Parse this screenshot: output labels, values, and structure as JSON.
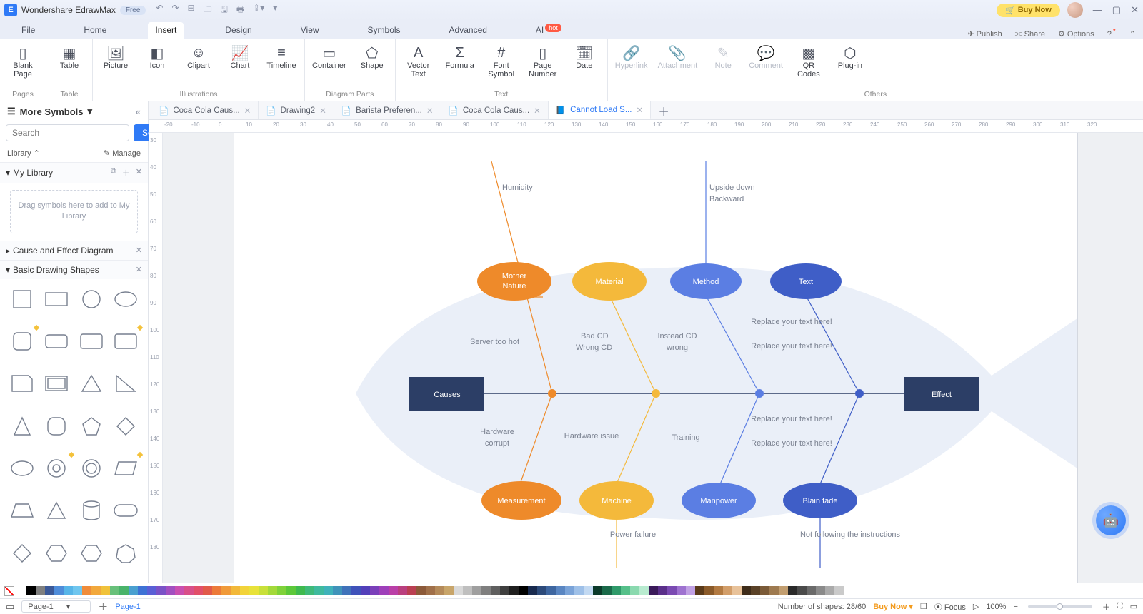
{
  "app": {
    "title": "Wondershare EdrawMax",
    "edition": "Free",
    "buy": "Buy Now"
  },
  "menu": {
    "items": [
      "File",
      "Home",
      "Insert",
      "Design",
      "View",
      "Symbols",
      "Advanced",
      "AI"
    ],
    "active": "Insert",
    "right": {
      "publish": "Publish",
      "share": "Share",
      "options": "Options"
    }
  },
  "ribbon": {
    "pages": {
      "label": "Pages",
      "blank": "Blank\nPage"
    },
    "table": {
      "label": "Table",
      "btn": "Table"
    },
    "illus": {
      "label": "Illustrations",
      "picture": "Picture",
      "icon": "Icon",
      "clipart": "Clipart",
      "chart": "Chart",
      "timeline": "Timeline"
    },
    "parts": {
      "label": "Diagram Parts",
      "container": "Container",
      "shape": "Shape"
    },
    "text": {
      "label": "Text",
      "vector": "Vector\nText",
      "formula": "Formula",
      "font": "Font\nSymbol",
      "pagen": "Page\nNumber",
      "date": "Date"
    },
    "others": {
      "label": "Others",
      "hyper": "Hyperlink",
      "attach": "Attachment",
      "note": "Note",
      "comment": "Comment",
      "qr": "QR\nCodes",
      "plugin": "Plug-in"
    }
  },
  "sidebar": {
    "header": "More Symbols",
    "search_ph": "Search",
    "search_btn": "Search",
    "library": "Library",
    "manage": "Manage",
    "mylib": "My Library",
    "drop": "Drag symbols here to add to My Library",
    "cause": "Cause and Effect Diagram",
    "basic": "Basic Drawing Shapes"
  },
  "tabs": [
    {
      "label": "Coca Cola Caus...",
      "active": false
    },
    {
      "label": "Drawing2",
      "active": false
    },
    {
      "label": "Barista Preferen...",
      "active": false
    },
    {
      "label": "Coca Cola Caus...",
      "active": false
    },
    {
      "label": "Cannot Load S...",
      "active": true
    }
  ],
  "ruler_marks": [
    -20,
    -10,
    0,
    10,
    20,
    30,
    40,
    50,
    60,
    70,
    80,
    90,
    100,
    110,
    120,
    130,
    140,
    150,
    160,
    170,
    180,
    190,
    200,
    210,
    220,
    230,
    240,
    250,
    260,
    270,
    280,
    290,
    300,
    310,
    320
  ],
  "vruler_marks": [
    30,
    40,
    50,
    60,
    70,
    80,
    90,
    100,
    110,
    120,
    130,
    140,
    150,
    160,
    170,
    180
  ],
  "diagram": {
    "causes": "Causes",
    "effect": "Effect",
    "top_cats": [
      "Mother Nature",
      "Material",
      "Method",
      "Text"
    ],
    "bot_cats": [
      "Measurement",
      "Machine",
      "Manpower",
      "Blain fade"
    ],
    "top_notes": {
      "humidity": "Humidity",
      "upside": "Upside down",
      "backward": "Backward",
      "server": "Server too hot",
      "badcd": "Bad CD",
      "wrongcd": "Wrong CD",
      "instead": "Instead CD wrong",
      "replace1a": "Replace your text here!",
      "replace1b": "Replace your text here!"
    },
    "bot_notes": {
      "hardware": "Hardware corrupt",
      "hwissue": "Hardware issue",
      "training": "Training",
      "replace2a": "Replace your text here!",
      "replace2b": "Replace your text here!",
      "power": "Power failure",
      "notfollow": "Not following the instructions"
    }
  },
  "status": {
    "page_sel": "Page-1",
    "page_link": "Page-1",
    "shapes": "Number of shapes: 28/60",
    "buy": "Buy Now",
    "focus": "Focus",
    "zoom": "100%"
  },
  "colors": [
    "#ffffff",
    "#000000",
    "#7f7f7f",
    "#3b5998",
    "#4e8cd9",
    "#57b5e8",
    "#6fc6ef",
    "#f08c3a",
    "#f2a83c",
    "#f0c23b",
    "#68c07a",
    "#49b36a",
    "#4aa0d0",
    "#3e72d5",
    "#5a5fd6",
    "#7a52c7",
    "#a24fc0",
    "#c94fb0",
    "#d84f8a",
    "#e14f6a",
    "#e15a4a",
    "#ec7a3a",
    "#f09a3a",
    "#f2b83a",
    "#f2d33a",
    "#e8e23a",
    "#c8e03a",
    "#a3d93a",
    "#7fd23a",
    "#5cc83a",
    "#3fba4f",
    "#3fba7a",
    "#3fba9e",
    "#3fb2ba",
    "#3f93ba",
    "#3f72ba",
    "#3f52ba",
    "#523fba",
    "#7a3fba",
    "#9e3fba",
    "#ba3fa8",
    "#ba3f7f",
    "#ba3f52",
    "#8c5a3a",
    "#a0704a",
    "#b48a5a",
    "#c8a56a",
    "#d9d9d9",
    "#bfbfbf",
    "#9f9f9f",
    "#7f7f7f",
    "#5f5f5f",
    "#3f3f3f",
    "#1f1f1f",
    "#000000",
    "#182a4e",
    "#2c4a7a",
    "#3e66a0",
    "#5a86c2",
    "#7aa3d8",
    "#9ec0e8",
    "#c2d9f2",
    "#0b3a2a",
    "#1a6a4a",
    "#2f9a6a",
    "#55c08a",
    "#8ad9af",
    "#b8ebd0",
    "#3a1a5a",
    "#5a2f8a",
    "#7a4ab2",
    "#9e72d0",
    "#c0a0e4",
    "#5a3a1a",
    "#8a5a2a",
    "#b27a42",
    "#d29e6a",
    "#e8c29a",
    "#3e2c1a",
    "#5a4228",
    "#7a5a38",
    "#9e7a50",
    "#c29e70",
    "#2a2a2a",
    "#4a4a4a",
    "#6a6a6a",
    "#8a8a8a",
    "#aaaaaa",
    "#cacaca"
  ]
}
